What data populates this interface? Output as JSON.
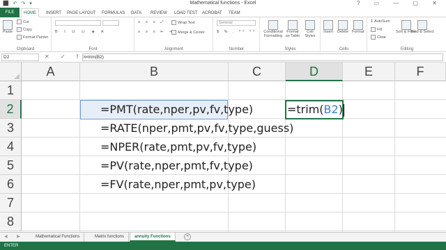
{
  "window": {
    "title": "Mathematical functions - Excel",
    "quick_access": "⬛ ↶ ↷ ▾",
    "controls": "? ▭ — ▢ ✕"
  },
  "tabs": [
    "FILE",
    "HOME",
    "INSERT",
    "PAGE LAYOUT",
    "FORMULAS",
    "DATA",
    "REVIEW",
    "LOAD TEST",
    "ACROBAT",
    "TEAM"
  ],
  "ribbon": {
    "clipboard": {
      "paste": "Paste",
      "cut": "Cut",
      "copy": "Copy",
      "format_painter": "Format Painter",
      "group": "Clipboard"
    },
    "font": {
      "group": "Font"
    },
    "alignment": {
      "wrap_text": "Wrap Text",
      "merge_center": "Merge & Center",
      "group": "Alignment"
    },
    "number": {
      "format": "General",
      "group": "Number"
    },
    "styles": {
      "conditional": "Conditional Formatting",
      "format_table": "Format as Table",
      "cell_styles": "Cell Styles",
      "group": "Styles"
    },
    "cells": {
      "insert": "Insert",
      "delete": "Delete",
      "format": "Format",
      "group": "Cells"
    },
    "editing": {
      "autosum": "AutoSum",
      "fill": "Fill",
      "clear": "Clear",
      "sort_filter": "Sort & Filter",
      "find_select": "Find & Select",
      "group": "Editing"
    }
  },
  "formula_bar": {
    "name_box": "D2",
    "fx_symbols": "✕ ✓ fx",
    "content": "=trim(B2)"
  },
  "grid": {
    "columns": [
      "A",
      "B",
      "C",
      "D",
      "E",
      "F"
    ],
    "rows": [
      "1",
      "2",
      "3",
      "4",
      "5",
      "6",
      "7",
      "8"
    ],
    "cells": {
      "B2": "=PMT(rate,nper,pv,fv,type)",
      "B3": "=RATE(nper,pmt,pv,fv,type,guess)",
      "B4": "=NPER(rate,pmt,pv,fv,type)",
      "B5": "=PV(rate,nper,pmt,fv,type)",
      "B6": "=FV(rate,nper,pmt,pv,type)",
      "D2_prefix": "=trim(",
      "D2_ref": "B2",
      "D2_suffix": ")"
    }
  },
  "sheets": {
    "nav": "◀ ▶",
    "tabs": [
      "Mathematical Functions",
      "Matrix functions",
      "annuity Functions"
    ],
    "active_index": 2,
    "add": "+"
  },
  "status": {
    "mode": "ENTER"
  }
}
